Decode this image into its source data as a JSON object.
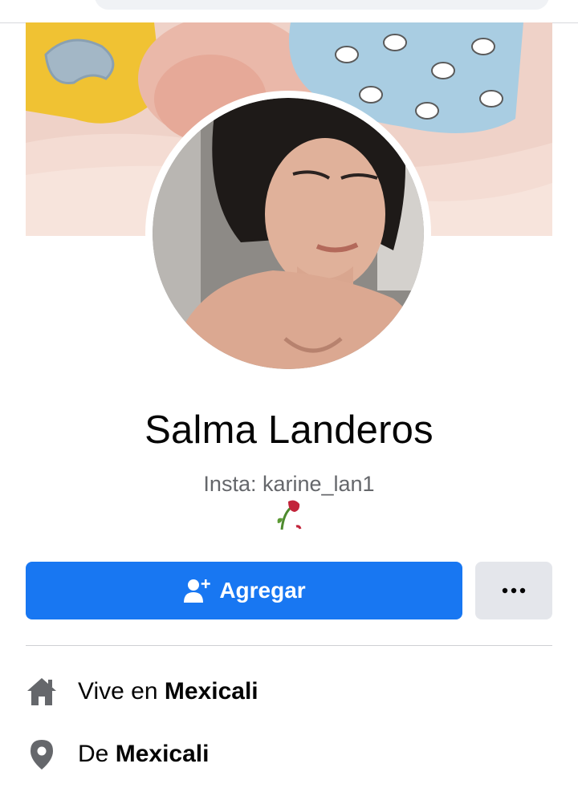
{
  "profile": {
    "name": "Salma Landeros",
    "bio": "Insta: karine_lan1",
    "bio_emoji": "🥀",
    "cover_photo": "sleeping-baby-cover-photo",
    "profile_photo": "profile-photo"
  },
  "actions": {
    "add_friend_label": "Agregar",
    "add_friend_icon": "add-friend-icon",
    "more_label": "•••",
    "more_icon": "more-options-icon"
  },
  "intro": {
    "items": [
      {
        "icon": "home-icon",
        "prefix": "Vive en",
        "value": "Mexicali"
      },
      {
        "icon": "location-pin-icon",
        "prefix": "De",
        "value": "Mexicali"
      }
    ]
  },
  "colors": {
    "primary_button": "#1877f2",
    "secondary_button": "#e4e6eb",
    "secondary_text": "#65676b",
    "icon_gray": "#65676b"
  }
}
